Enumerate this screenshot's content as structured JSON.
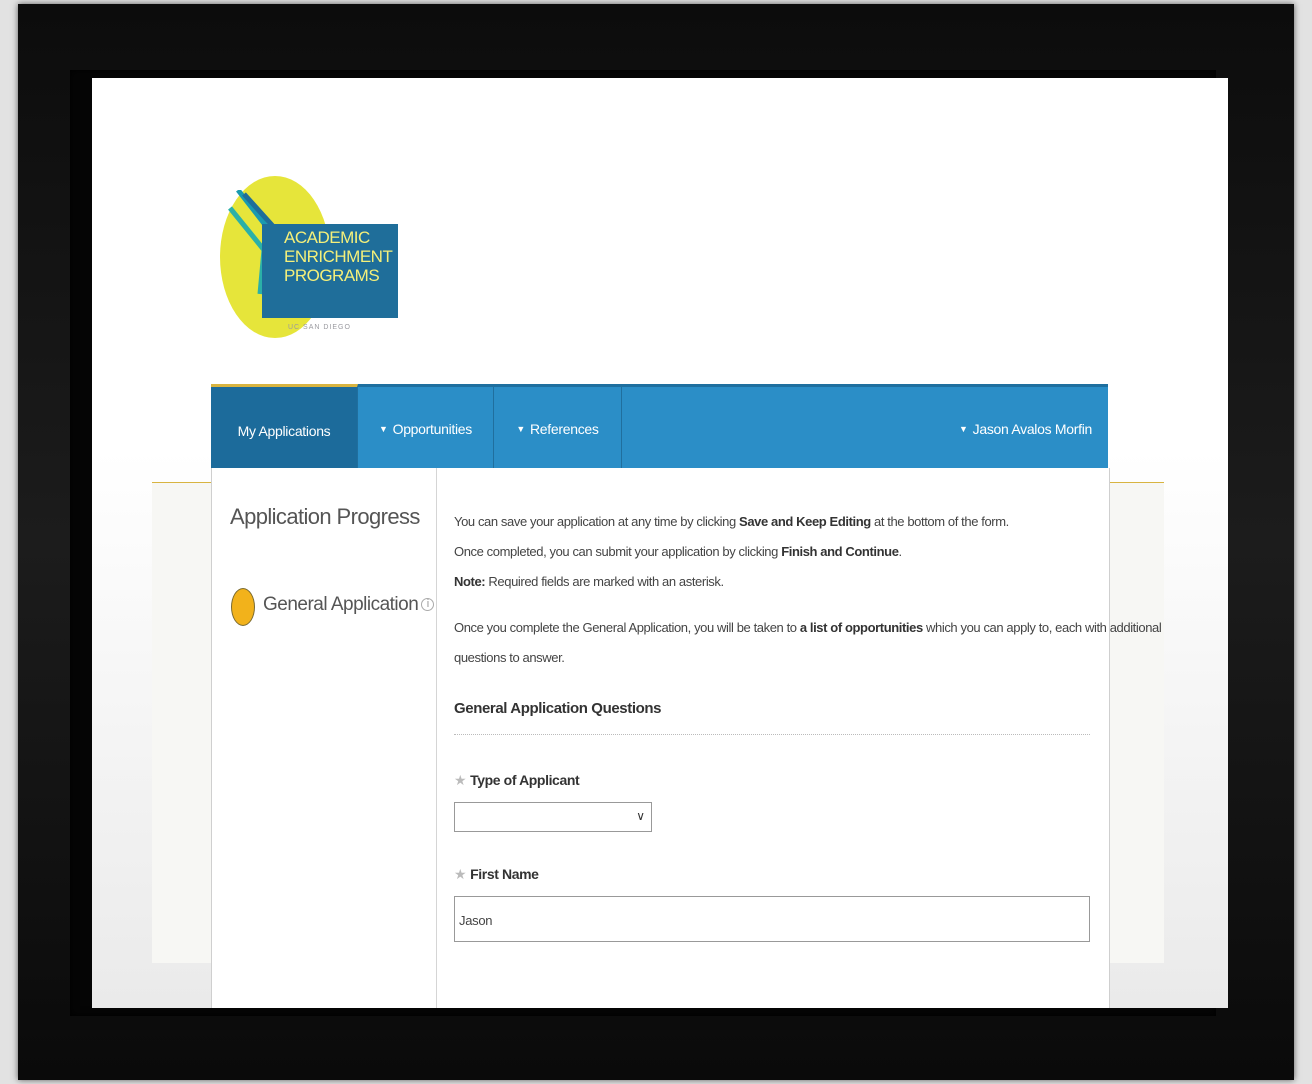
{
  "logo": {
    "lines": "ACADEMIC\nENRICHMENT\nPROGRAMS",
    "sub": "UC SAN DIEGO"
  },
  "nav": {
    "items": [
      {
        "label": "My Applications"
      },
      {
        "label": "Opportunities"
      },
      {
        "label": "References"
      }
    ],
    "user": "Jason Avalos Morfin",
    "caret": "▼"
  },
  "sidebar": {
    "title": "Application Progress",
    "step": "General Application",
    "info": "i"
  },
  "intro": {
    "line1_a": "You can save your application at any time by clicking ",
    "line1_b": "Save and Keep Editing",
    "line1_c": " at the bottom of the form.",
    "line2_a": "Once completed, you can submit your application by clicking ",
    "line2_b": "Finish and Continue",
    "line2_c": ".",
    "line3_a": "Note:",
    "line3_b": " Required fields are marked with an asterisk.",
    "line4_a": "Once you complete the General Application, you will be taken to ",
    "line4_b": "a list of opportunities",
    "line4_c": " which you can apply to, each with additional",
    "line5": "questions to answer."
  },
  "section": {
    "heading": "General Application Questions"
  },
  "fields": {
    "type_label": "Type of Applicant",
    "type_value": "",
    "first_label": "First Name",
    "first_value": "Jason",
    "asterisk": "★",
    "chevron": "∨"
  }
}
